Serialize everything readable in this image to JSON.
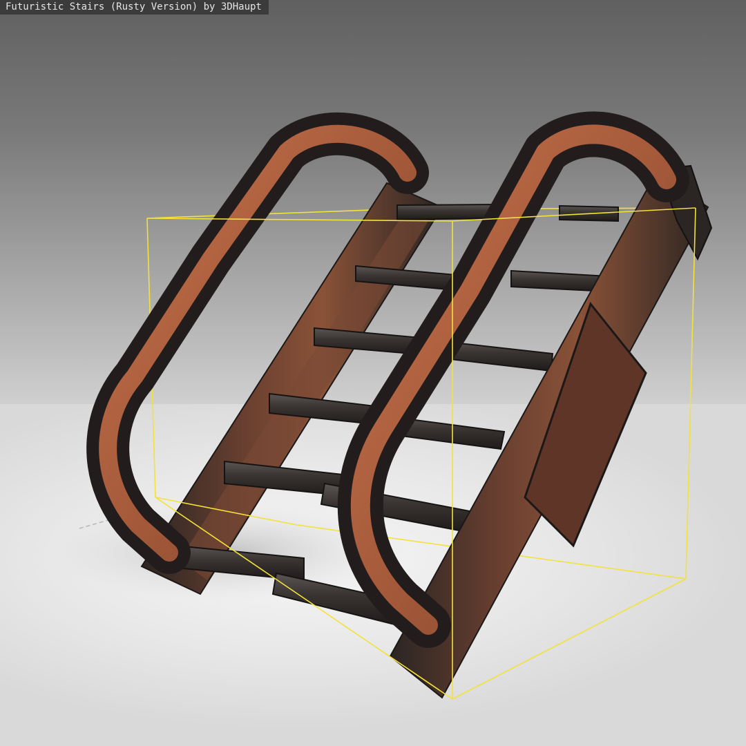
{
  "viewer": {
    "title": "Futuristic Stairs (Rusty Version) by 3DHaupt"
  },
  "colors": {
    "bounding_box": "#f2e23a",
    "metal_dark": "#2a2624",
    "rust": "#b0603e",
    "rust_dark": "#6b3a28",
    "floor": "#ececec"
  }
}
